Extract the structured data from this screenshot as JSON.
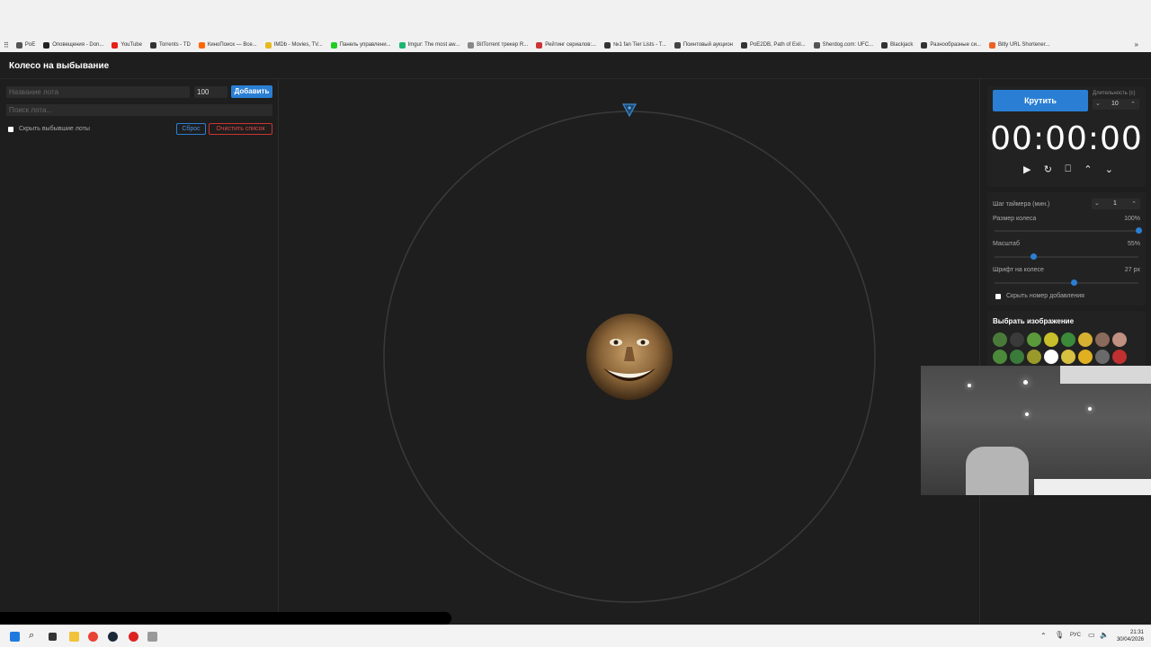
{
  "bookmarks": [
    {
      "label": "PoE",
      "color": "#555"
    },
    {
      "label": "Оповещения - Don...",
      "color": "#222"
    },
    {
      "label": "YouTube",
      "color": "#e62117"
    },
    {
      "label": "Torrents - TD",
      "color": "#333"
    },
    {
      "label": "КиноПоиск — Все...",
      "color": "#f60"
    },
    {
      "label": "IMDb - Movies, TV...",
      "color": "#e6b91e"
    },
    {
      "label": "Панель управлени...",
      "color": "#2c2"
    },
    {
      "label": "Imgur: The most aw...",
      "color": "#1bb76e"
    },
    {
      "label": "BitTorrent трекер R...",
      "color": "#888"
    },
    {
      "label": "Рейтинг сериалов:...",
      "color": "#c33"
    },
    {
      "label": "№1 fan Tier Lists - T...",
      "color": "#333"
    },
    {
      "label": "Поинтовый аукцион",
      "color": "#444"
    },
    {
      "label": "PoE2DB, Path of Exil...",
      "color": "#333"
    },
    {
      "label": "Sherdog.com: UFC...",
      "color": "#555"
    },
    {
      "label": "Blackjack",
      "color": "#333"
    },
    {
      "label": "Разнообразные си...",
      "color": "#333"
    },
    {
      "label": "Bitly URL Shortener...",
      "color": "#ee6123"
    }
  ],
  "app": {
    "title": "Колесо на выбывание"
  },
  "left_panel": {
    "lot_name_placeholder": "Название лота",
    "lot_amount": "100",
    "add_label": "Добавить",
    "search_placeholder": "Поиск лота...",
    "hide_dropped_label": "Скрыть выбывшие лоты",
    "reset_label": "Сброс",
    "clear_label": "Очистить список"
  },
  "right_panel": {
    "spin_label": "Крутить",
    "duration_label": "Длительность (с)",
    "duration_value": "10",
    "timer": "00:00:00",
    "timer_step_label": "Шаг таймера (мин.)",
    "timer_step_value": "1",
    "wheel_size_label": "Размер колеса",
    "wheel_size_value": "100%",
    "wheel_size_level": 1.0,
    "scale_label": "Масштаб",
    "scale_value": "55%",
    "scale_level": 0.27,
    "font_label": "Шрифт на колесе",
    "font_value": "27 px",
    "font_level": 0.55,
    "hide_number_label": "Скрыть номер добавления",
    "choose_image_label": "Выбрать изображение"
  },
  "taskbar": {
    "lang": "РУС",
    "time": "21:31",
    "date": "30/04/2026"
  },
  "colors": {
    "accent": "#2a7fd4",
    "danger": "#d43a3a",
    "background": "#1e1e1e"
  }
}
